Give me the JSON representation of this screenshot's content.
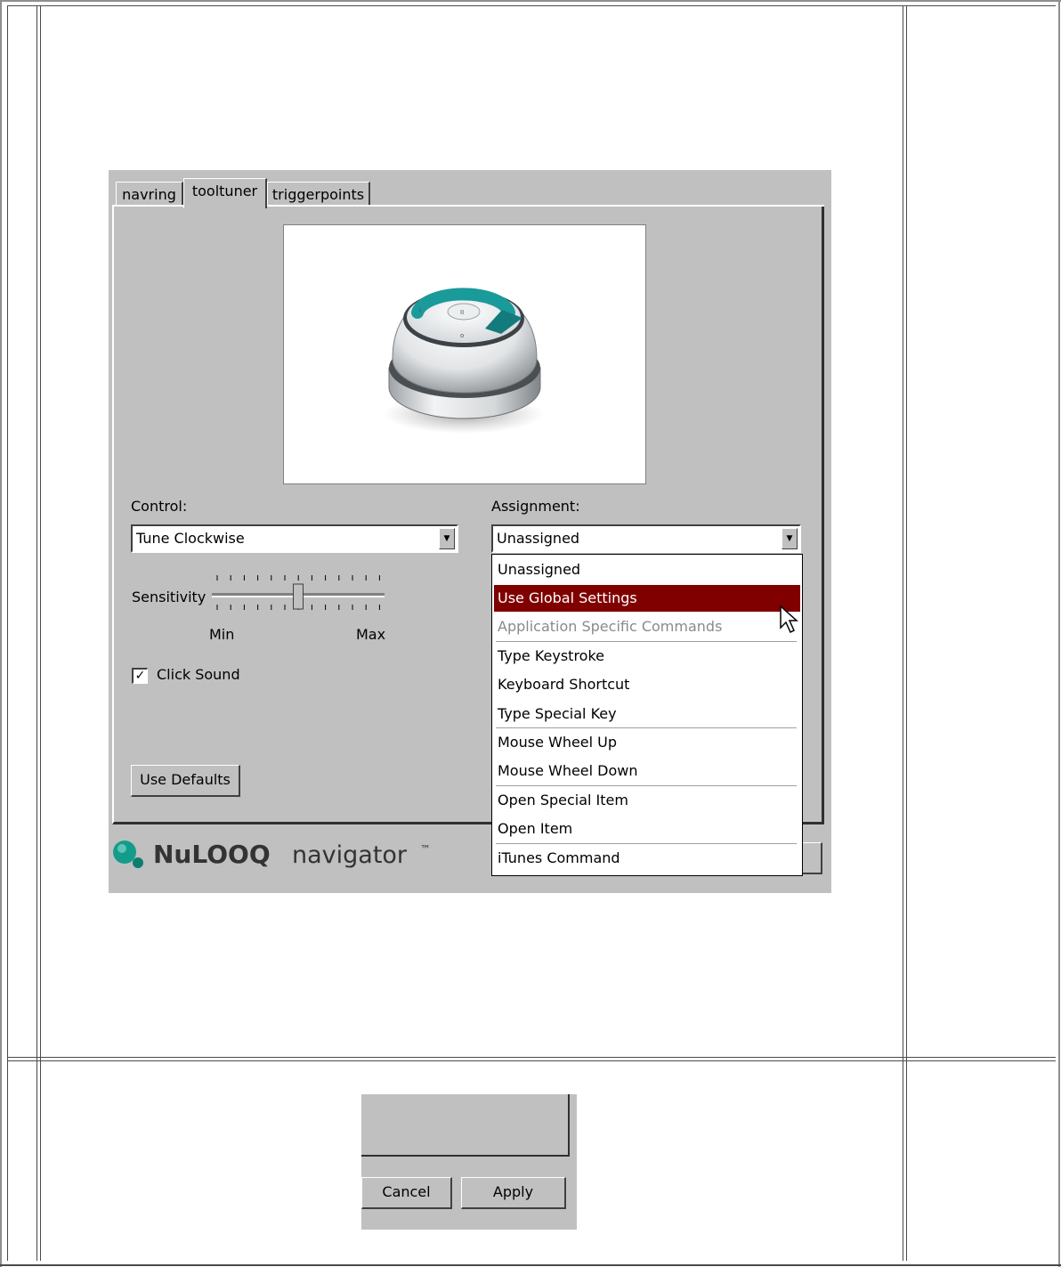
{
  "tabs": [
    {
      "label": "navring"
    },
    {
      "label": "tooltuner",
      "selected": true
    },
    {
      "label": "triggerpoints"
    }
  ],
  "control": {
    "label": "Control:",
    "value": "Tune Clockwise"
  },
  "assignment": {
    "label": "Assignment:",
    "value": "Unassigned"
  },
  "sensitivity": {
    "label": "Sensitivity",
    "min_label": "Min",
    "max_label": "Max",
    "level": 0.5
  },
  "click_sound": {
    "label": "Click Sound",
    "checked": true
  },
  "use_defaults": "Use Defaults",
  "brand": {
    "name": "NuLOOQ",
    "product": "navigator",
    "tm": "™"
  },
  "dropdown": {
    "options": [
      {
        "label": "Unassigned"
      },
      {
        "label": "Use Global Settings",
        "highlighted": true
      },
      {
        "label": "Application Specific Commands",
        "disabled": true
      },
      {
        "label": "Type Keystroke"
      },
      {
        "label": "Keyboard Shortcut"
      },
      {
        "label": "Type Special Key"
      },
      {
        "label": "Mouse Wheel Up"
      },
      {
        "label": "Mouse Wheel Down"
      },
      {
        "label": "Open Special Item"
      },
      {
        "label": "Open Item"
      },
      {
        "label": "iTunes Command"
      }
    ]
  },
  "footer": {
    "cancel": "Cancel",
    "apply": "Apply"
  },
  "colors": {
    "panel": "#c0c0c0",
    "highlight": "#800000",
    "accent": "#1a9a9a"
  }
}
